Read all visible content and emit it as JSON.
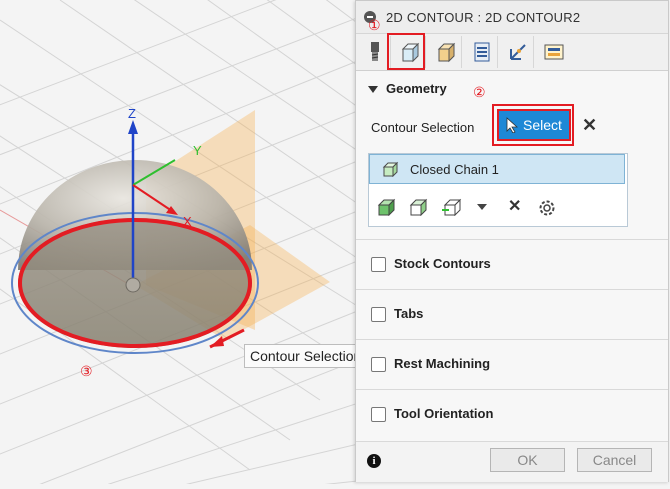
{
  "viewport": {
    "axes": {
      "z": "Z",
      "y": "Y",
      "x": "X"
    },
    "tooltip": "Contour Selection"
  },
  "panel": {
    "title": "2D CONTOUR : 2D CONTOUR2",
    "tabs": [
      "tool-tab",
      "geometry-tab",
      "heights-tab",
      "passes-tab",
      "linking-tab",
      "simulate-tab"
    ],
    "geometry": {
      "header": "Geometry",
      "contour_label": "Contour Selection",
      "select_label": "Select",
      "chain_item": "Closed Chain 1"
    },
    "sections": [
      {
        "label": "Stock Contours",
        "checked": false
      },
      {
        "label": "Tabs",
        "checked": false
      },
      {
        "label": "Rest Machining",
        "checked": false
      },
      {
        "label": "Tool Orientation",
        "checked": false
      }
    ],
    "footer": {
      "info": "i",
      "ok_label": "OK",
      "cancel_label": "Cancel"
    }
  },
  "markers": {
    "m1": "①",
    "m2": "②",
    "m3": "③"
  },
  "colors": {
    "accent": "#1e88d6",
    "highlight_red": "#e31c23",
    "chain_bg": "#cfe6f4",
    "plane_orange": "#f5b04d"
  }
}
